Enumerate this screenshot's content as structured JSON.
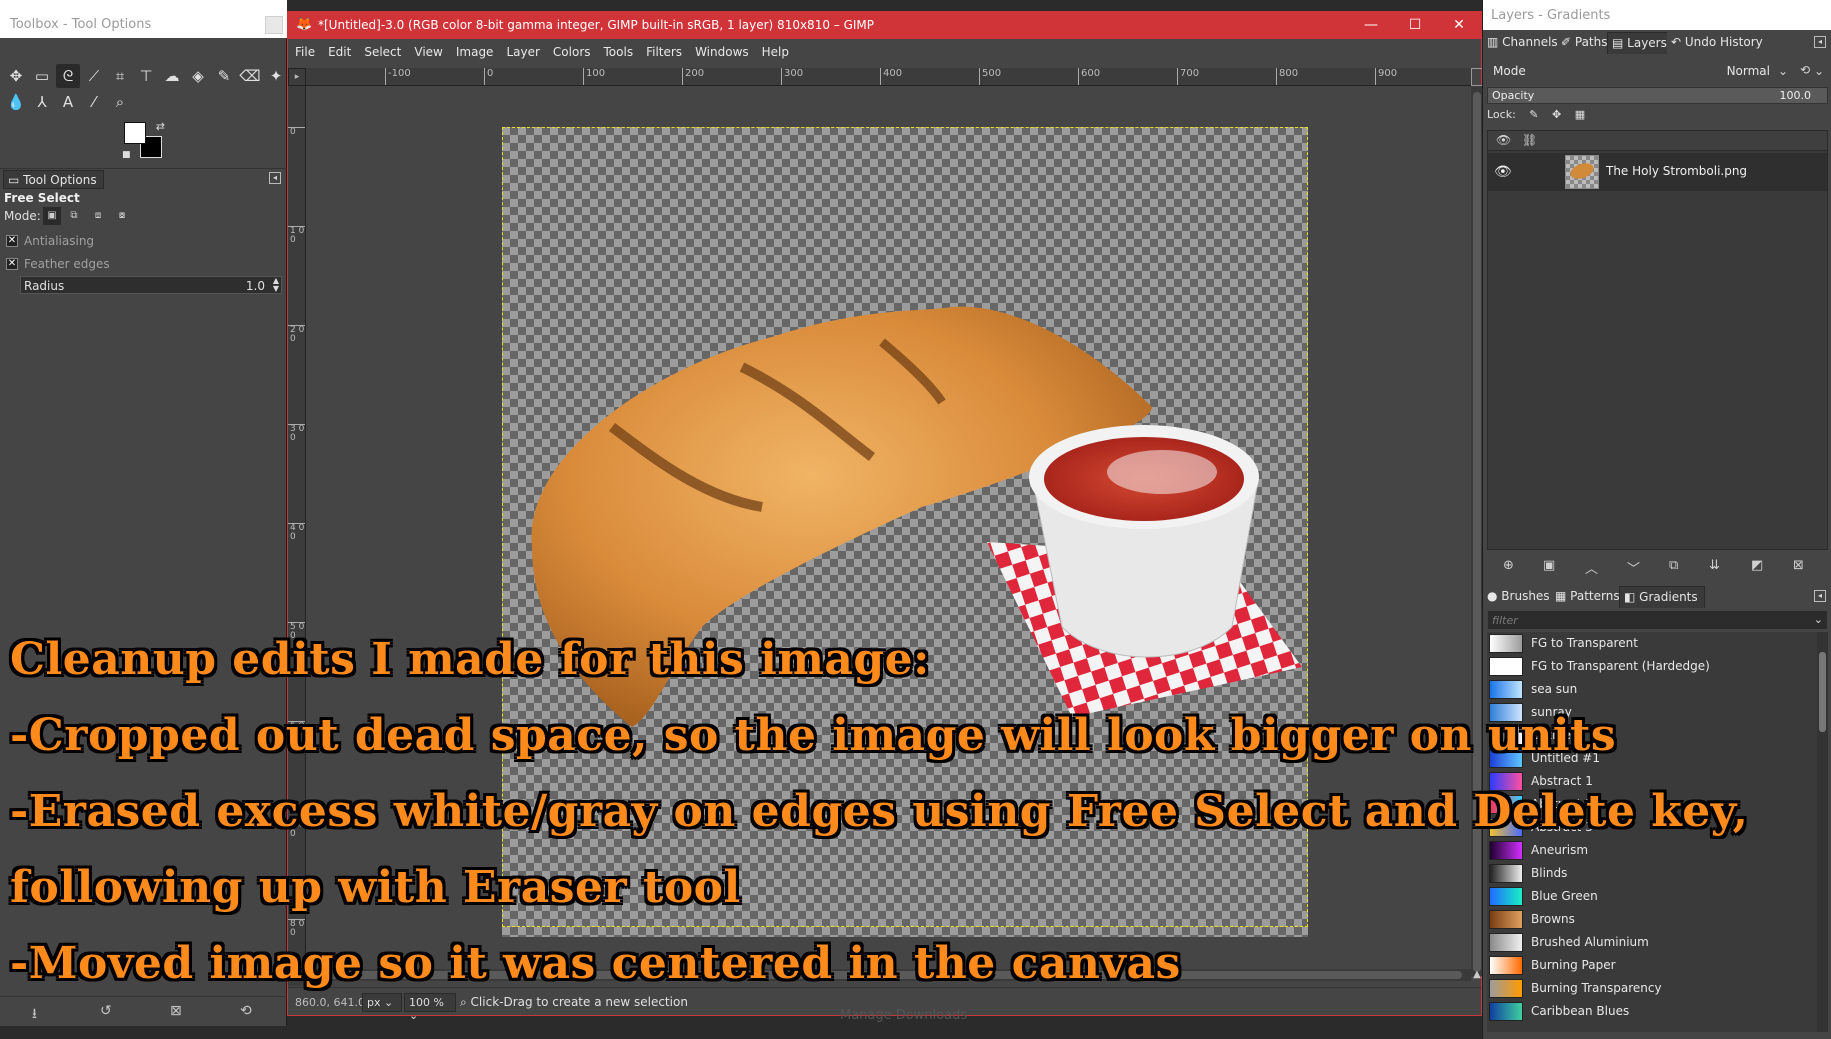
{
  "toolbox": {
    "title": "Toolbox - Tool Options",
    "tab": "Tool Options",
    "tool_name": "Free Select",
    "mode_label": "Mode:",
    "antialiasing": "Antialiasing",
    "feather": "Feather edges",
    "radius_label": "Radius",
    "radius_value": "1.0"
  },
  "main": {
    "title": "*[Untitled]-3.0 (RGB color 8-bit gamma integer, GIMP built-in sRGB, 1 layer) 810x810 – GIMP",
    "menu": [
      "File",
      "Edit",
      "Select",
      "View",
      "Image",
      "Layer",
      "Colors",
      "Tools",
      "Filters",
      "Windows",
      "Help"
    ],
    "hruler_labels": [
      "-100",
      "0",
      "100",
      "200",
      "300",
      "400",
      "500",
      "600",
      "700",
      "800",
      "900"
    ],
    "vruler_labels": [
      "0",
      "1 0 0",
      "2 0 0",
      "3 0 0",
      "4 0 0",
      "5 0 0",
      "6 0 0",
      "7 0 0",
      "8 0 0"
    ],
    "status": {
      "coords": "860.0, 641.0",
      "unit": "px",
      "zoom": "100 %",
      "message": "Click-Drag to create a new selection"
    }
  },
  "dock": {
    "title": "Layers - Gradients",
    "tabs_top": [
      "Channels",
      "Paths",
      "Layers",
      "Undo History"
    ],
    "mode_label": "Mode",
    "mode_value": "Normal",
    "opacity_label": "Opacity",
    "opacity_value": "100.0",
    "lock_label": "Lock:",
    "layer_name": "The Holy Stromboli.png",
    "tabs_bottom": [
      "Brushes",
      "Patterns",
      "Gradients"
    ],
    "filter_placeholder": "filter",
    "gradients": [
      {
        "name": "FG to Transparent",
        "colors": [
          "#ffffff",
          "#9c9c9c"
        ]
      },
      {
        "name": "FG to Transparent (Hardedge)",
        "colors": [
          "#ffffff",
          "#ffffff"
        ]
      },
      {
        "name": "sea sun",
        "colors": [
          "#1a73e8",
          "#bfe6ff"
        ]
      },
      {
        "name": "sunray",
        "colors": [
          "#2f7fd8",
          "#cfe4ff"
        ]
      },
      {
        "name": "Untitled",
        "colors": [
          "#000000",
          "#ffffff"
        ]
      },
      {
        "name": "Untitled #1",
        "colors": [
          "#1c3fd6",
          "#5fc6ff"
        ]
      },
      {
        "name": "Abstract 1",
        "colors": [
          "#2b3cff",
          "#ff4fa0"
        ]
      },
      {
        "name": "Abstract 2",
        "colors": [
          "#ff2f5a",
          "#30d0ff"
        ]
      },
      {
        "name": "Abstract 3",
        "colors": [
          "#f0c030",
          "#4a6cff"
        ]
      },
      {
        "name": "Aneurism",
        "colors": [
          "#200030",
          "#d030ff"
        ]
      },
      {
        "name": "Blinds",
        "colors": [
          "#222222",
          "#eeeeee"
        ]
      },
      {
        "name": "Blue Green",
        "colors": [
          "#1e6bff",
          "#19f0c4"
        ]
      },
      {
        "name": "Browns",
        "colors": [
          "#7a3e12",
          "#e0a060"
        ]
      },
      {
        "name": "Brushed Aluminium",
        "colors": [
          "#8a8a8a",
          "#f0f0f0"
        ]
      },
      {
        "name": "Burning Paper",
        "colors": [
          "#ffffff",
          "#ff6a00"
        ]
      },
      {
        "name": "Burning Transparency",
        "colors": [
          "#9c9c9c",
          "#ff9a00"
        ]
      },
      {
        "name": "Caribbean Blues",
        "colors": [
          "#1040a0",
          "#40d0a0"
        ]
      }
    ]
  },
  "overlay": {
    "lines": [
      "Cleanup edits I made for this image:",
      "-Cropped out dead space, so the image will look bigger on units",
      "-Erased excess white/gray on edges using Free Select and Delete key,",
      "following up with Eraser tool",
      "-Moved image so it was centered in the canvas"
    ],
    "downloads": "Manage Downloads"
  }
}
